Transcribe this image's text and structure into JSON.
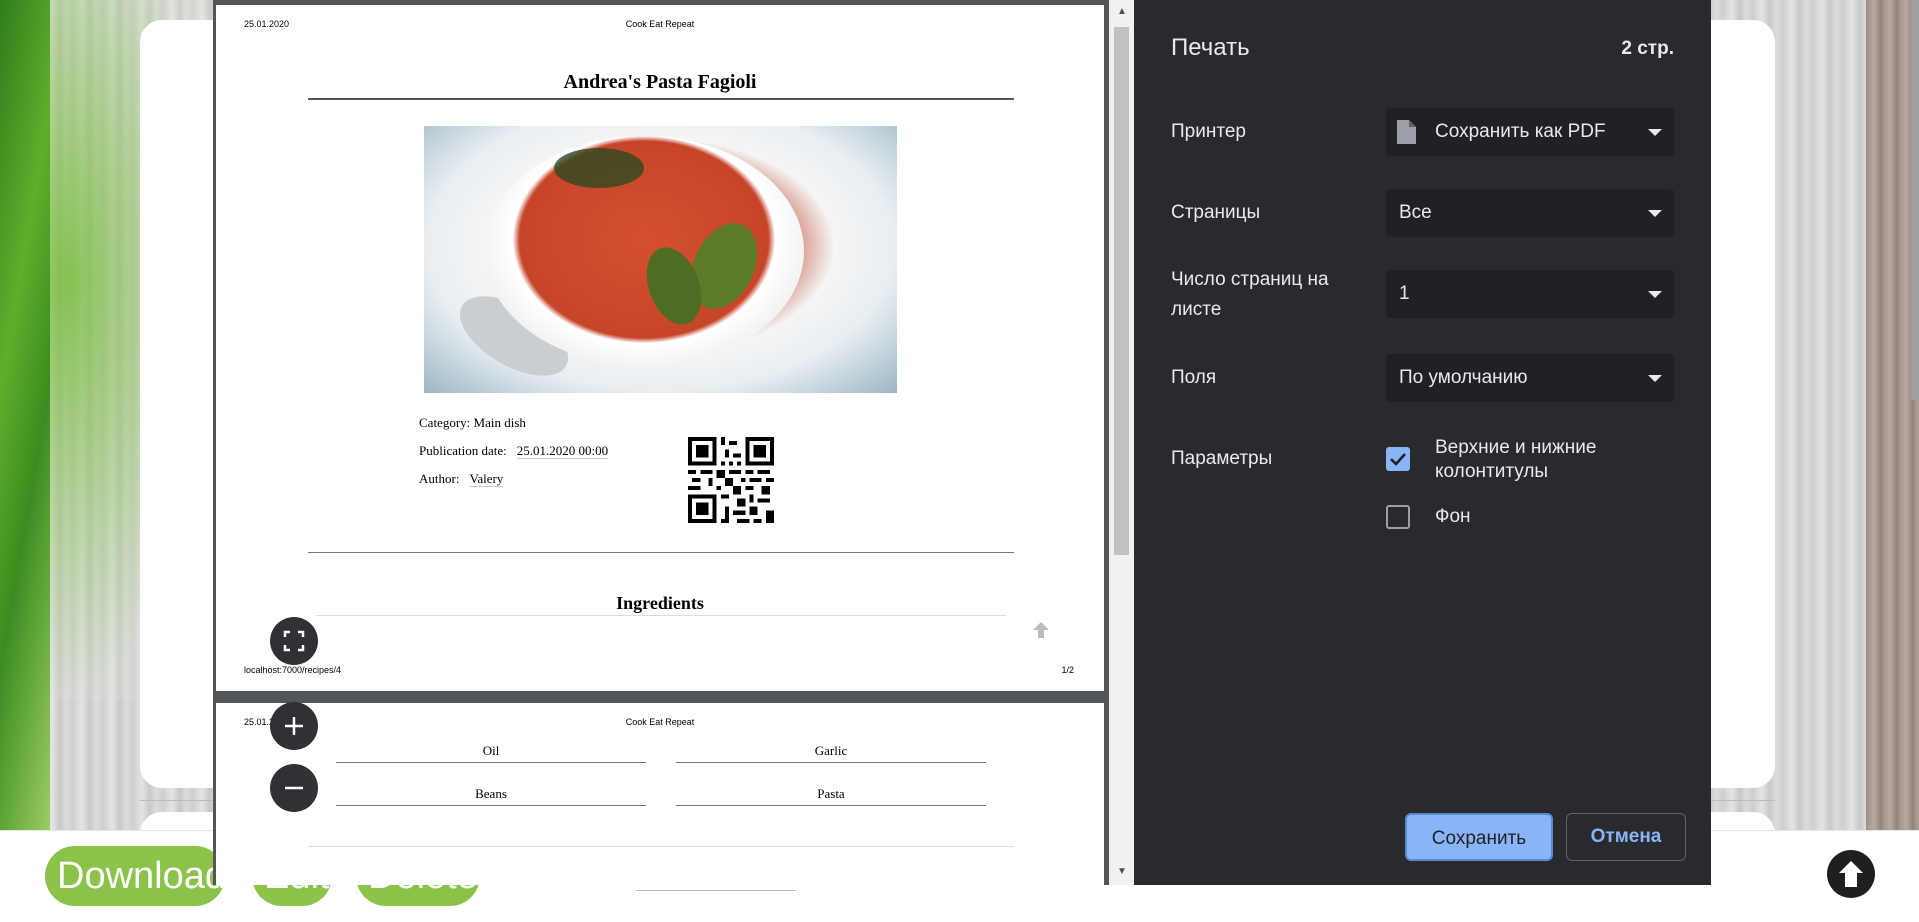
{
  "site": {
    "bottom_buttons": {
      "download": "Download",
      "edit": "Edit",
      "delete": "Delete"
    }
  },
  "preview": {
    "page1": {
      "header_date": "25.01.2020",
      "header_site": "Cook Eat Repeat",
      "title": "Andrea's Pasta Fagioli",
      "category_label": "Category: Main dish",
      "publication_label": "Publication date:",
      "publication_value": "25.01.2020 00:00",
      "author_label": "Author:",
      "author_value": "Valery",
      "ingredients_title": "Ingredients",
      "footer_url": "localhost:7000/recipes/4",
      "footer_page": "1/2"
    },
    "page2": {
      "header_date": "25.01.2",
      "header_site": "Cook Eat Repeat",
      "ingredients": [
        "Oil",
        "Garlic",
        "Beans",
        "Pasta"
      ]
    },
    "zoom_controls": {
      "fit": "⛶",
      "zoom_in": "+",
      "zoom_out": "−"
    }
  },
  "print_dialog": {
    "title": "Печать",
    "page_count": "2 стр.",
    "printer_label": "Принтер",
    "printer_value": "Сохранить как PDF",
    "pages_label": "Страницы",
    "pages_value": "Все",
    "pages_per_sheet_label": "Число страниц на листе",
    "pages_per_sheet_value": "1",
    "margins_label": "Поля",
    "margins_value": "По умолчанию",
    "options_label": "Параметры",
    "headers_footers_label": "Верхние и нижние колонтитулы",
    "headers_footers_checked": true,
    "background_label": "Фон",
    "background_checked": false,
    "save_button": "Сохранить",
    "cancel_button": "Отмена"
  },
  "colors": {
    "accent": "#8ab4f8",
    "dialog_bg": "#292a2d",
    "green_button": "#8bc34a"
  }
}
